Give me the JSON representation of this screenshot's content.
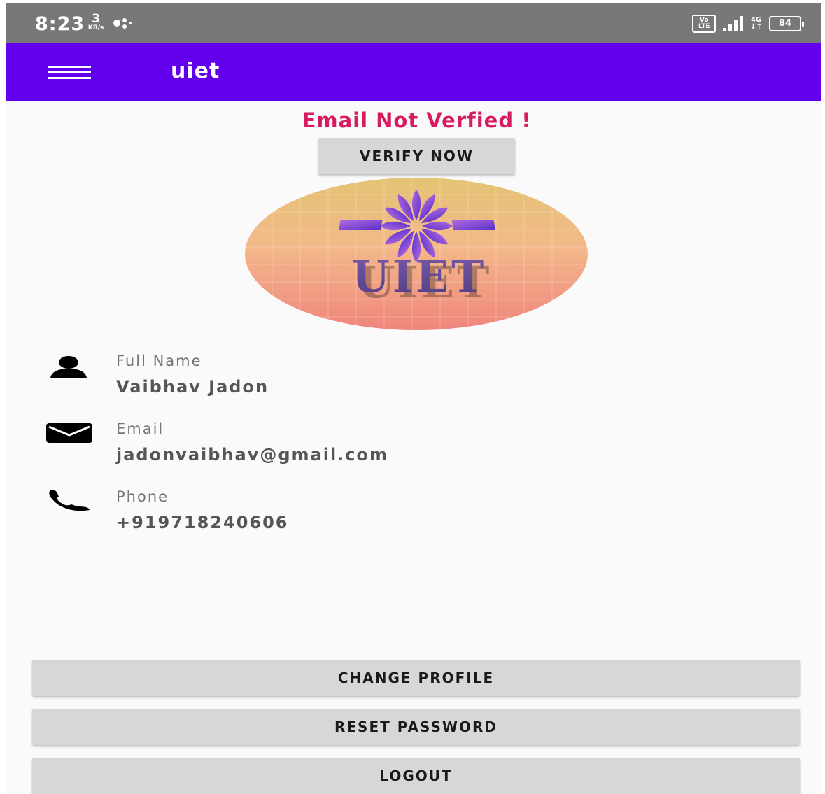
{
  "status_bar": {
    "time": "8:23",
    "net_speed_value": "3",
    "net_speed_unit": "KB/s",
    "volte_line1": "Vo",
    "volte_line2": "LTE",
    "network_type": "4G",
    "battery_level": "84"
  },
  "app_bar": {
    "title": "uiet"
  },
  "verification": {
    "warning_text": "Email Not Verfied !",
    "verify_button_label": "VERIFY NOW",
    "warning_color": "#d81b60"
  },
  "profile": {
    "logo_text": "UIET",
    "fields": [
      {
        "label": "Full Name",
        "value": "Vaibhav Jadon",
        "icon": "person-icon"
      },
      {
        "label": "Email",
        "value": "jadonvaibhav@gmail.com",
        "icon": "mail-icon"
      },
      {
        "label": "Phone",
        "value": "+919718240606",
        "icon": "phone-icon"
      }
    ]
  },
  "actions": {
    "change_profile_label": "CHANGE PROFILE",
    "reset_password_label": "RESET PASSWORD",
    "logout_label": "LOGOUT"
  },
  "colors": {
    "app_bar": "#6200ee",
    "status_bar": "#787878",
    "button": "#d6d7d7"
  }
}
